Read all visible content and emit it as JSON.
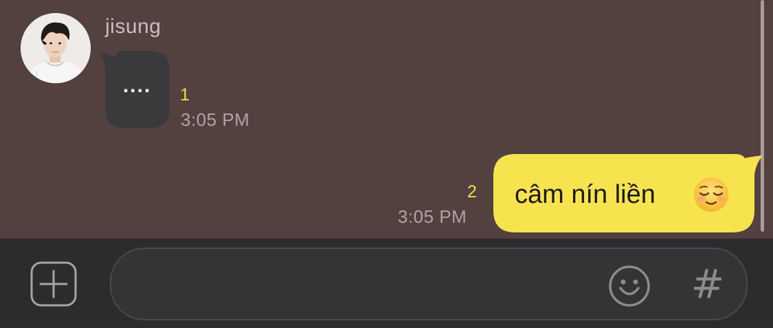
{
  "incoming": {
    "sender_name": "jisung",
    "message_text": "....",
    "unread_count": "1",
    "timestamp": "3:05 PM"
  },
  "outgoing": {
    "message_text": "câm nín liền",
    "emoji": "relieved-face",
    "unread_count": "2",
    "timestamp": "3:05 PM"
  },
  "composer": {
    "input_value": "",
    "input_placeholder": "",
    "hash_label": "#",
    "icons": {
      "add": "plus-icon",
      "emoticon": "smiley-icon",
      "hash": "hash-icon"
    }
  },
  "colors": {
    "chat_background": "#534140",
    "outgoing_bubble": "#f7e34e",
    "incoming_bubble": "#3a3a3c",
    "unread_count": "#f5df3e",
    "bottom_bar": "#2c2c2e"
  }
}
